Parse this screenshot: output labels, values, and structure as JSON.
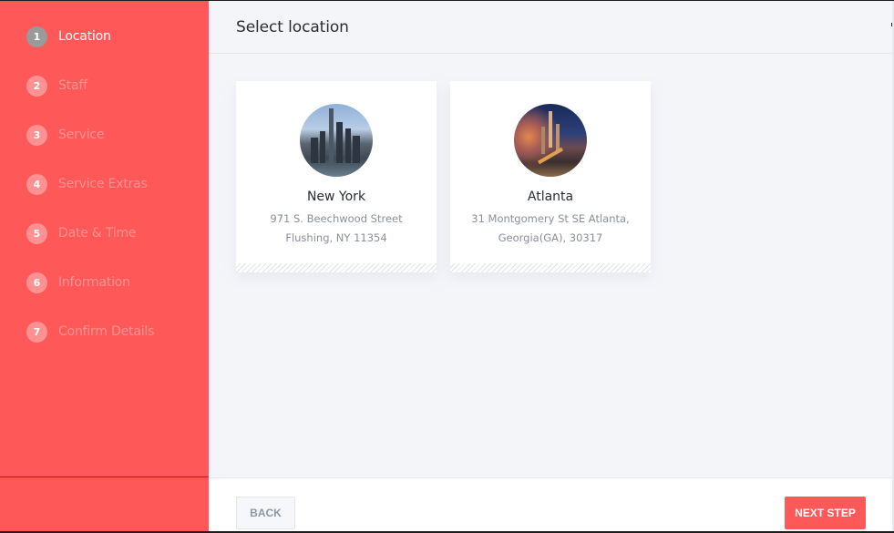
{
  "sidebar": {
    "steps": [
      {
        "number": "1",
        "label": "Location",
        "active": true
      },
      {
        "number": "2",
        "label": "Staff",
        "active": false
      },
      {
        "number": "3",
        "label": "Service",
        "active": false
      },
      {
        "number": "4",
        "label": "Service Extras",
        "active": false
      },
      {
        "number": "5",
        "label": "Date & Time",
        "active": false
      },
      {
        "number": "6",
        "label": "Information",
        "active": false
      },
      {
        "number": "7",
        "label": "Confirm Details",
        "active": false
      }
    ]
  },
  "header": {
    "title": "Select location"
  },
  "locations": [
    {
      "name": "New York",
      "address_line1": "971 S. Beechwood Street",
      "address_line2": "Flushing, NY 11354",
      "image": "new-york-skyline-photo"
    },
    {
      "name": "Atlanta",
      "address_line1": "31 Montgomery St SE Atlanta,",
      "address_line2": "Georgia(GA), 30317",
      "image": "atlanta-skyline-photo"
    }
  ],
  "footer": {
    "back_label": "BACK",
    "next_label": "NEXT STEP"
  },
  "colors": {
    "accent": "#fe5858",
    "active_step": "#9a9a9a",
    "background": "#f4f5f9"
  }
}
